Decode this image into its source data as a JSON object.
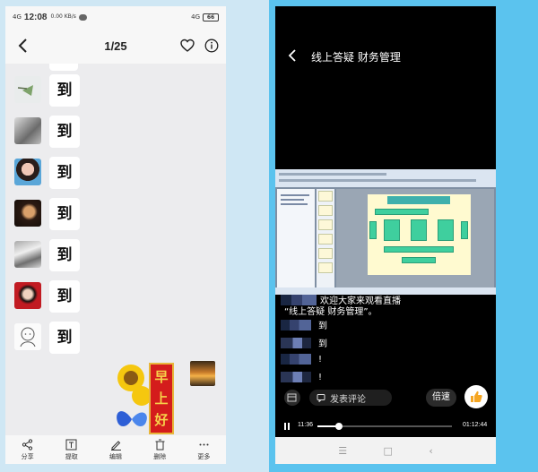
{
  "left": {
    "status": {
      "signal": "4G",
      "time": "12:08",
      "net_speed": "0.00 KB/s",
      "network": "4G",
      "battery": "66"
    },
    "nav": {
      "title": "1/25"
    },
    "messages": [
      {
        "text": "到",
        "avatar": "avatar-1"
      },
      {
        "text": "到",
        "avatar": "avatar-2"
      },
      {
        "text": "到",
        "avatar": "avatar-3"
      },
      {
        "text": "到",
        "avatar": "avatar-4"
      },
      {
        "text": "到",
        "avatar": "avatar-5"
      },
      {
        "text": "到",
        "avatar": "avatar-6"
      },
      {
        "text": "到",
        "avatar": "avatar-7"
      }
    ],
    "sticker": {
      "chars": [
        "早",
        "上",
        "好"
      ]
    },
    "toolbar": [
      {
        "label": "分享",
        "icon": "share-icon"
      },
      {
        "label": "提取",
        "icon": "extract-icon"
      },
      {
        "label": "编辑",
        "icon": "edit-icon"
      },
      {
        "label": "删除",
        "icon": "delete-icon"
      },
      {
        "label": "更多",
        "icon": "more-icon"
      }
    ]
  },
  "right": {
    "header": {
      "title": "线上答疑  财务管理"
    },
    "comments": {
      "welcome_1": "欢迎大家来观看直播",
      "welcome_2": "“线上答疑 财务管理”。",
      "items": [
        "到",
        "到",
        "!",
        "!"
      ]
    },
    "controls": {
      "comment_placeholder": "发表评论",
      "speed": "倍速"
    },
    "progress": {
      "current": "11:36",
      "duration": "01:12:44",
      "fraction": 0.16
    }
  }
}
